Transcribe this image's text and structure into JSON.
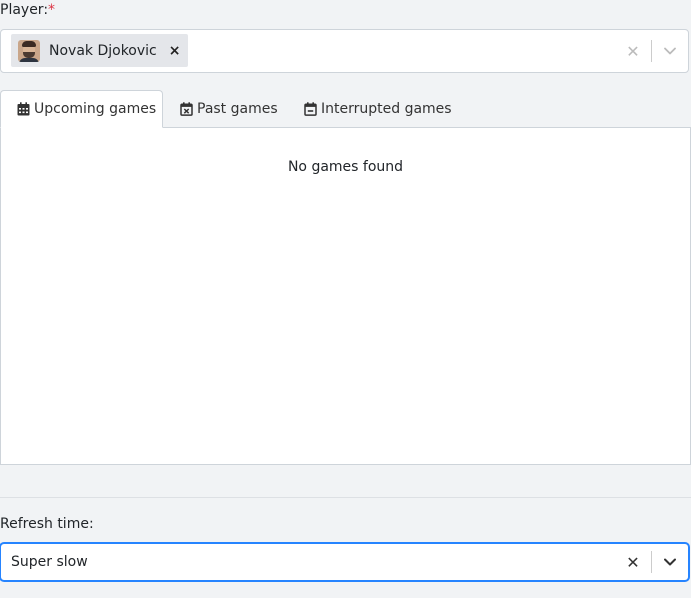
{
  "player": {
    "label": "Player:",
    "required_mark": "*",
    "selected": {
      "name": "Novak Djokovic",
      "remove_symbol": "×"
    }
  },
  "tabs": [
    {
      "label": "Upcoming games",
      "icon": "calendar-icon",
      "active": true
    },
    {
      "label": "Past games",
      "icon": "calendar-x-icon",
      "active": false
    },
    {
      "label": "Interrupted games",
      "icon": "calendar-minus-icon",
      "active": false
    }
  ],
  "panel": {
    "empty_message": "No games found"
  },
  "refresh": {
    "label": "Refresh time:",
    "value": "Super slow"
  },
  "colors": {
    "focus": "#2684ff",
    "required": "#dc3545"
  }
}
